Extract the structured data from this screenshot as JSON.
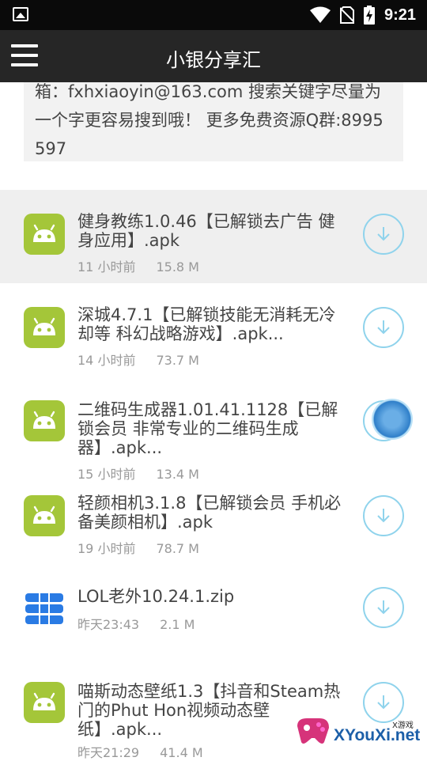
{
  "status_bar": {
    "time": "9:21"
  },
  "app_bar": {
    "title": "小银分享汇"
  },
  "notice": {
    "text": "箱：fxhxiaoyin@163.com 搜索关键字尽量为一个字更容易搜到哦！ 更多免费资源Q群:8995597"
  },
  "files": [
    {
      "title_lines": [
        "健身教练1.0.46【已解锁去广告 健",
        "身应用】.apk"
      ],
      "time": "11 小时前",
      "size": "15.8 M",
      "icon": "android-icon",
      "selected": true
    },
    {
      "title_lines": [
        "深城4.7.1【已解锁技能无消耗无冷",
        "却等 科幻战略游戏】.apk..."
      ],
      "time": "14 小时前",
      "size": "73.7 M",
      "icon": "android-icon"
    },
    {
      "title_lines": [
        "二维码生成器1.01.41.1128【已解",
        "锁会员 非常专业的二维码生成",
        "器】.apk..."
      ],
      "time": "15 小时前",
      "size": "13.4 M",
      "icon": "android-icon"
    },
    {
      "title_lines": [
        "轻颜相机3.1.8【已解锁会员 手机必",
        "备美颜相机】.apk"
      ],
      "time": "19 小时前",
      "size": "78.7 M",
      "icon": "android-icon"
    },
    {
      "title_lines": [
        "LOL老外10.24.1.zip"
      ],
      "time": "昨天23:43",
      "size": "2.1 M",
      "icon": "zip-icon"
    },
    {
      "title_lines": [
        "喵斯动态壁纸1.3【抖音和Steam热",
        "门的Phut Hon视频动态壁",
        "纸】.apk..."
      ],
      "time": "昨天21:29",
      "size": "41.4 M",
      "icon": "android-icon"
    }
  ],
  "watermark": {
    "text": "XYouXi.net",
    "small": "X游戏"
  }
}
